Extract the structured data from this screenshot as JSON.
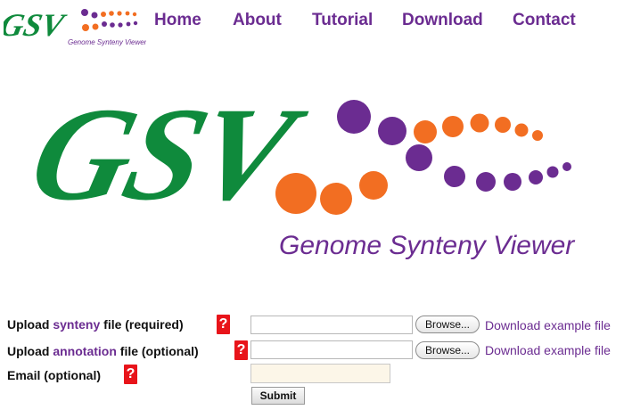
{
  "header": {
    "logo_text": "GSV",
    "logo_caption": "Genome Synteny Viewer",
    "nav": [
      {
        "label": "Home"
      },
      {
        "label": "About"
      },
      {
        "label": "Tutorial"
      },
      {
        "label": "Download"
      },
      {
        "label": "Contact"
      }
    ]
  },
  "hero": {
    "logo_text": "GSV",
    "caption": "Genome Synteny Viewer"
  },
  "form": {
    "synteny": {
      "prefix": "Upload ",
      "keyword": "synteny",
      "suffix": " file (required)",
      "help": "?",
      "browse_label": "Browse...",
      "example_link": "Download example file"
    },
    "annotation": {
      "prefix": "Upload ",
      "keyword": "annotation",
      "suffix": " file (optional)",
      "help": "?",
      "browse_label": "Browse...",
      "example_link": "Download example file"
    },
    "email": {
      "label": "Email (optional)",
      "help": "?",
      "value": ""
    },
    "submit_label": "Submit"
  },
  "colors": {
    "brand_green": "#0f8a3c",
    "brand_purple": "#6b2c91",
    "brand_orange": "#f26e22",
    "help_red": "#e8141a"
  }
}
